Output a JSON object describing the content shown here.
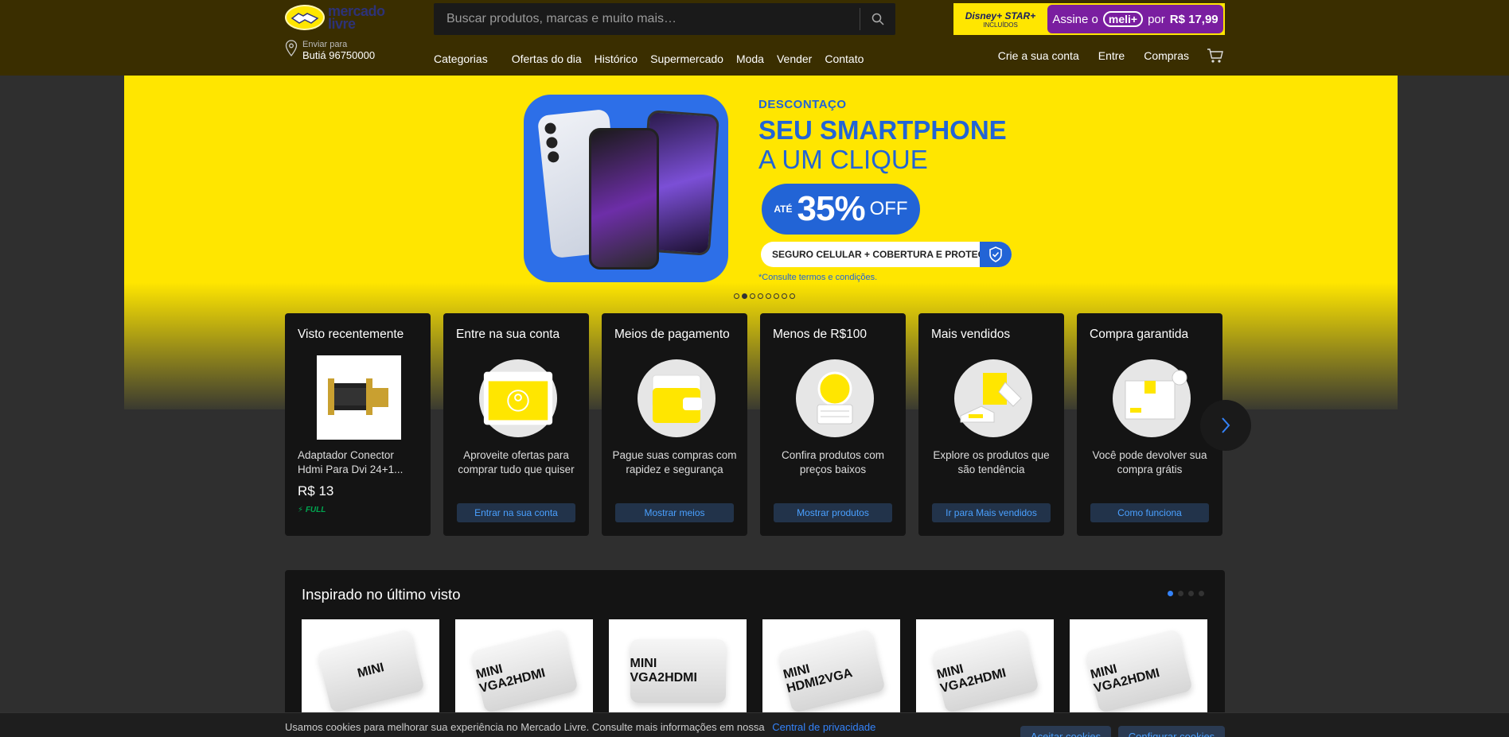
{
  "header": {
    "logo_text_1": "mercado",
    "logo_text_2": "livre",
    "search_placeholder": "Buscar produtos, marcas e muito mais…",
    "promo": {
      "disney_top": "Disney+ STAR+",
      "disney_sub": "INCLUÍDOS",
      "assine": "Assine o",
      "meli": "meli+",
      "por": "por",
      "price": "R$ 17,99"
    },
    "ship_label": "Enviar para",
    "ship_city": "Butiá 96750000",
    "nav": [
      "Categorias",
      "Ofertas do dia",
      "Histórico",
      "Supermercado",
      "Moda",
      "Vender",
      "Contato"
    ],
    "user_nav": [
      "Crie a sua conta",
      "Entre",
      "Compras"
    ]
  },
  "banner": {
    "eyebrow": "DESCONTAÇO",
    "title1": "SEU SMARTPHONE",
    "title2": "A UM CLIQUE",
    "ate": "ATÉ",
    "pct": "35%",
    "off": "OFF",
    "seguro": "SEGURO CELULAR + COBERTURA E PROTEÇÃO*",
    "terms": "*Consulte termos e condições.",
    "slide_count": 8,
    "active_slide": 2
  },
  "cards": {
    "recent": {
      "title": "Visto recentemente",
      "name": "Adaptador Conector Hdmi Para Dvi 24+1...",
      "price": "R$ 13",
      "badge": "FULL"
    },
    "account": {
      "title": "Entre na sua conta",
      "desc": "Aproveite ofertas para comprar tudo que quiser",
      "button": "Entrar na sua conta"
    },
    "payment": {
      "title": "Meios de pagamento",
      "desc": "Pague suas compras com rapidez e segurança",
      "button": "Mostrar meios"
    },
    "under100": {
      "title": "Menos de R$100",
      "desc": "Confira produtos com preços baixos",
      "button": "Mostrar produtos"
    },
    "bestsellers": {
      "title": "Mais vendidos",
      "desc": "Explore os produtos que são tendência",
      "button": "Ir para Mais vendidos"
    },
    "guarantee": {
      "title": "Compra garantida",
      "desc": "Você pode devolver sua compra grátis",
      "button": "Como funciona"
    }
  },
  "inspired": {
    "title": "Inspirado no último visto",
    "products": [
      "MINI",
      "MINI VGA2HDMI",
      "MINI VGA2HDMI",
      "MINI HDMI2VGA",
      "MINI VGA2HDMI",
      "MINI VGA2HDMI"
    ]
  },
  "cookie": {
    "text": "Usamos cookies para melhorar sua experiência no Mercado Livre. Consulte mais informações em nossa",
    "link": "Central de privacidade",
    "accept": "Aceitar cookies",
    "configure": "Configurar cookies"
  },
  "colors": {
    "brand_yellow": "#ffe600",
    "brand_blue": "#2264d6",
    "link_blue": "#3483fa",
    "header_bg": "#3a2e00",
    "disney_purple": "#7a1ea0"
  }
}
